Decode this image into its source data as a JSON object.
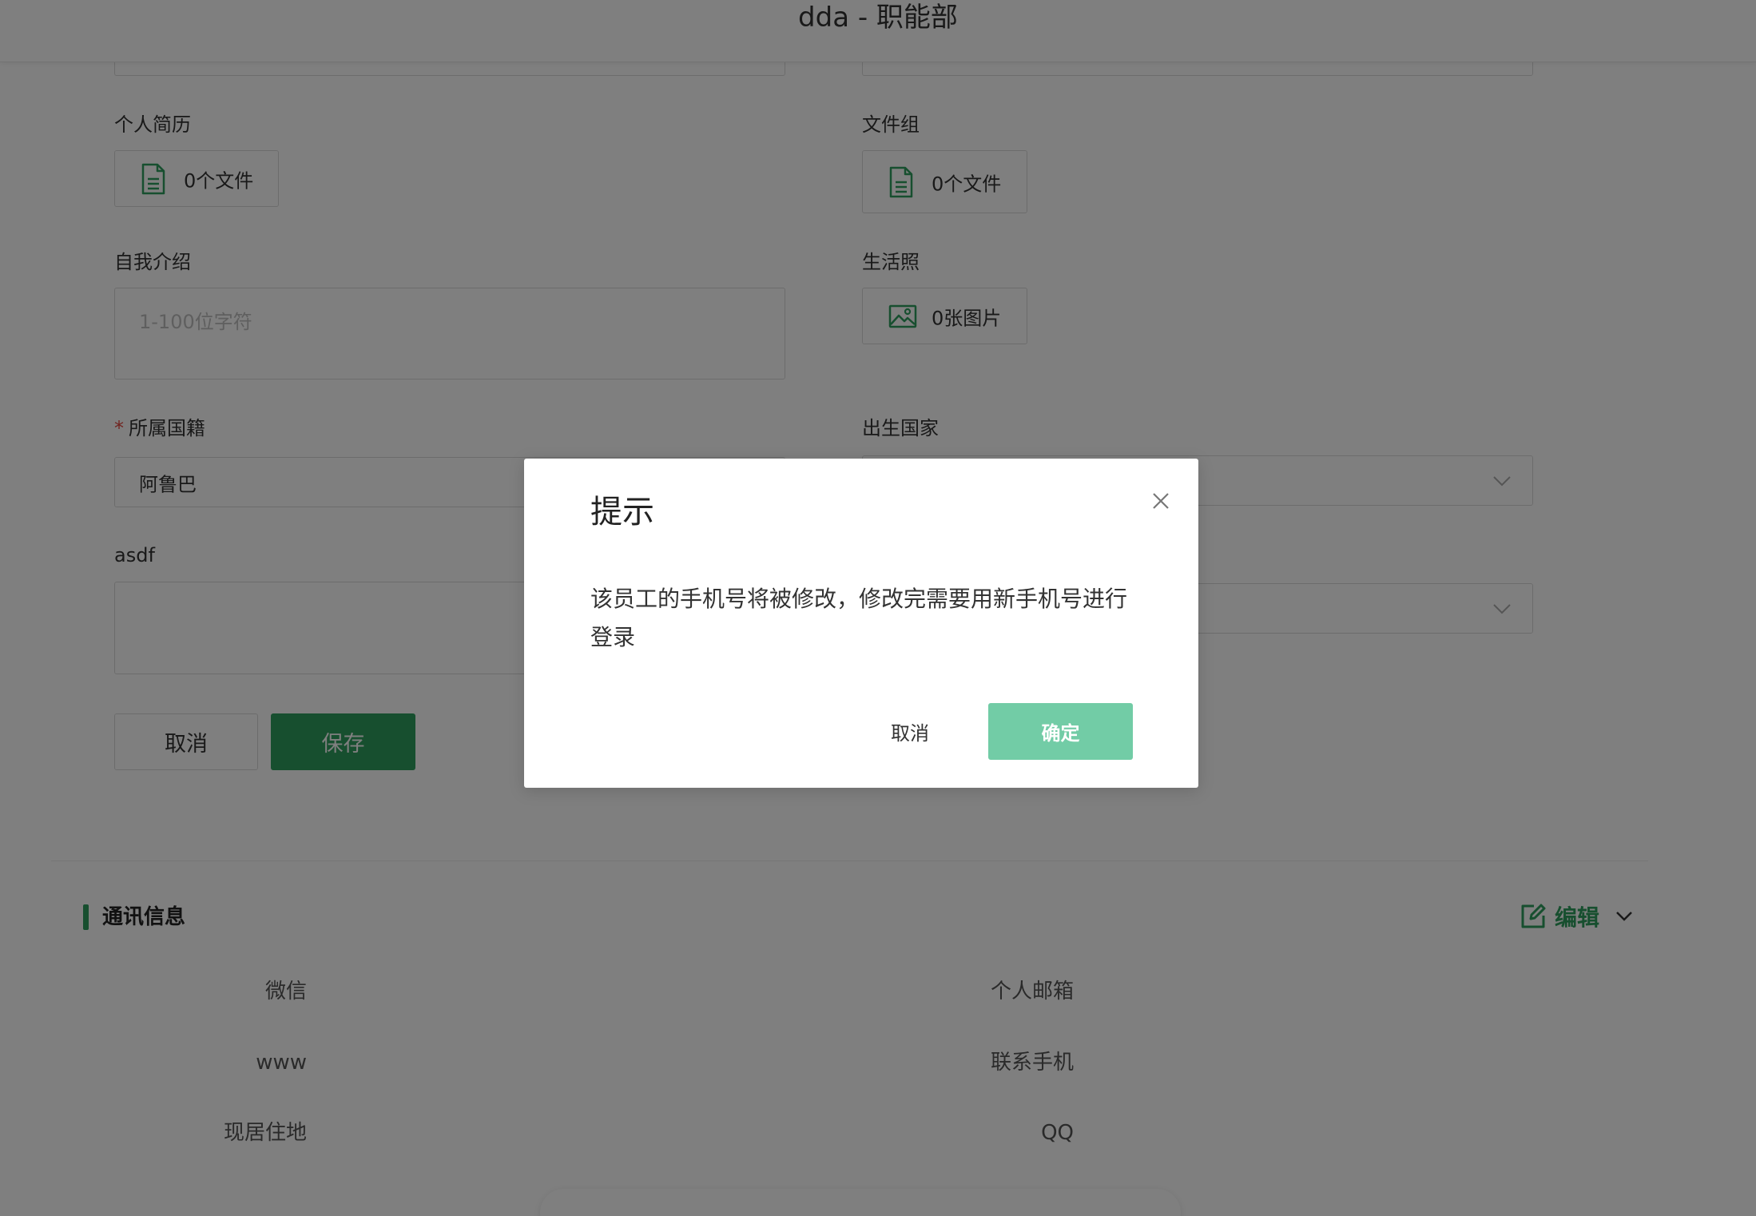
{
  "header": {
    "title": "dda - 职能部"
  },
  "form": {
    "resume": {
      "label": "个人简历",
      "file_count": "0个文件"
    },
    "file_group": {
      "label": "文件组",
      "file_count": "0个文件"
    },
    "self_intro": {
      "label": "自我介绍",
      "placeholder": "1-100位字符"
    },
    "life_photo": {
      "label": "生活照",
      "photo_count": "0张图片"
    },
    "nationality": {
      "required_mark": "*",
      "label": "所属国籍",
      "value": "阿鲁巴"
    },
    "birth_country": {
      "label": "出生国家",
      "value": ""
    },
    "asdf": {
      "label": "asdf",
      "value": ""
    },
    "cancel_label": "取消",
    "save_label": "保存"
  },
  "comm": {
    "title": "通讯信息",
    "edit_label": "编辑",
    "fields": [
      "微信",
      "个人邮箱",
      "www",
      "联系手机",
      "现居住地",
      "QQ"
    ]
  },
  "modal": {
    "title": "提示",
    "message": "该员工的手机号将被修改，修改完需要用新手机号进行登录",
    "cancel_label": "取消",
    "confirm_label": "确定"
  },
  "icons": {
    "file": "file-icon",
    "image": "image-icon",
    "close": "close-icon",
    "chevron": "chevron-down-icon",
    "edit": "edit-icon"
  },
  "colors": {
    "primary": "#2e9e5e",
    "confirm": "#72cca6",
    "required": "#e2463f"
  }
}
